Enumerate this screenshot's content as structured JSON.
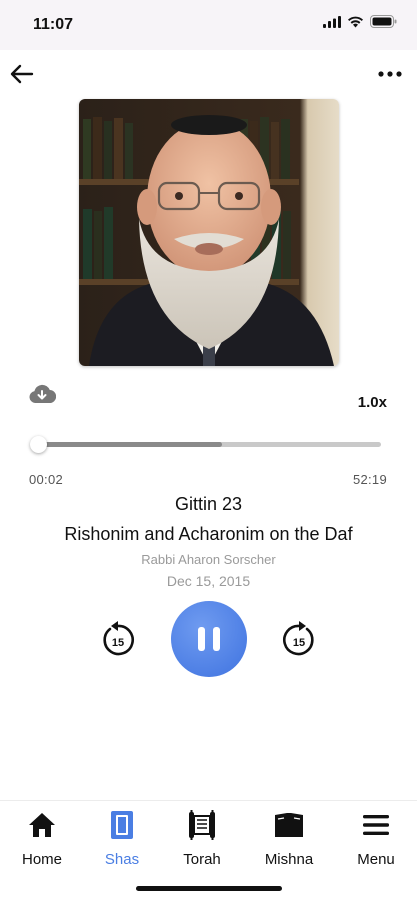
{
  "status_bar": {
    "time": "11:07"
  },
  "player": {
    "speed": "1.0x",
    "elapsed": "00:02",
    "total": "52:19",
    "progress_fraction": 0.005,
    "buffer_fraction": 0.54,
    "title": "Gittin 23",
    "subtitle": "Rishonim and Acharonim on the Daf",
    "author": "Rabbi Aharon Sorscher",
    "date": "Dec 15, 2015",
    "skip_back_seconds": "15",
    "skip_forward_seconds": "15"
  },
  "tabs": [
    {
      "label": "Home",
      "icon": "home-icon",
      "active": false
    },
    {
      "label": "Shas",
      "icon": "book-icon",
      "active": true
    },
    {
      "label": "Torah",
      "icon": "torah-scroll-icon",
      "active": false
    },
    {
      "label": "Mishna",
      "icon": "open-book-icon",
      "active": false
    },
    {
      "label": "Menu",
      "icon": "hamburger-menu-icon",
      "active": false
    }
  ],
  "colors": {
    "accent": "#4a7ee3",
    "play_button": "#4f80e6",
    "muted_text": "#9a9a9a"
  }
}
